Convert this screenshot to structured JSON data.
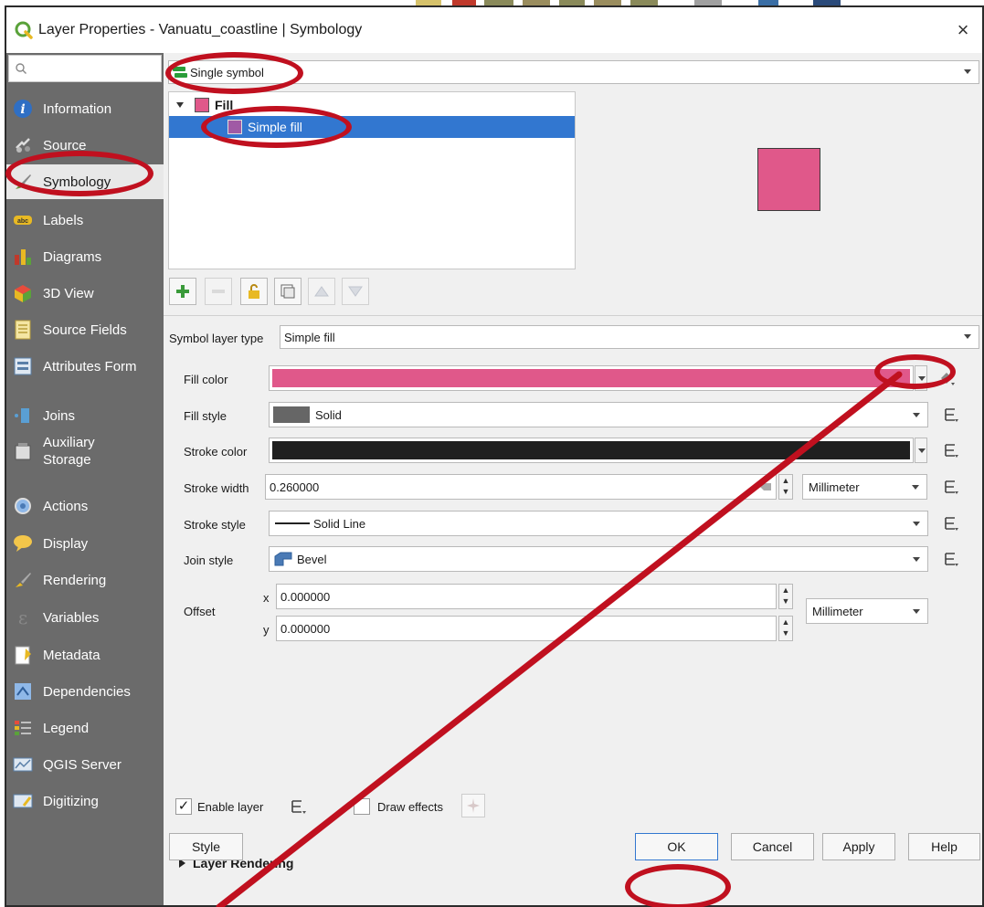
{
  "window": {
    "title": "Layer Properties - Vanuatu_coastline | Symbology",
    "close_glyph": "×"
  },
  "sidebar": {
    "items": [
      {
        "label": "Information",
        "icon": "info-icon"
      },
      {
        "label": "Source",
        "icon": "source-icon"
      },
      {
        "label": "Symbology",
        "icon": "symbology-brush-icon",
        "active": true
      },
      {
        "label": "Labels",
        "icon": "labels-abc-icon"
      },
      {
        "label": "Diagrams",
        "icon": "diagrams-icon"
      },
      {
        "label": "3D View",
        "icon": "3d-view-icon"
      },
      {
        "label": "Source Fields",
        "icon": "source-fields-icon"
      },
      {
        "label": "Attributes Form",
        "icon": "attributes-form-icon"
      },
      {
        "label": "Joins",
        "icon": "joins-icon"
      },
      {
        "label": "Auxiliary Storage",
        "icon": "auxiliary-storage-icon"
      },
      {
        "label": "Actions",
        "icon": "actions-gear-icon"
      },
      {
        "label": "Display",
        "icon": "display-speech-icon"
      },
      {
        "label": "Rendering",
        "icon": "rendering-brush-icon"
      },
      {
        "label": "Variables",
        "icon": "variables-epsilon-icon"
      },
      {
        "label": "Metadata",
        "icon": "metadata-icon"
      },
      {
        "label": "Dependencies",
        "icon": "dependencies-icon"
      },
      {
        "label": "Legend",
        "icon": "legend-icon"
      },
      {
        "label": "QGIS Server",
        "icon": "qgis-server-icon"
      },
      {
        "label": "Digitizing",
        "icon": "digitizing-icon"
      }
    ]
  },
  "renderer": {
    "selected": "Single symbol"
  },
  "symbol_tree": {
    "root_label": "Fill",
    "child_label": "Simple fill"
  },
  "symbol_layer": {
    "type_label": "Symbol layer type",
    "type_value": "Simple fill",
    "fill_color_label": "Fill color",
    "fill_color": "#e0588a",
    "fill_style_label": "Fill style",
    "fill_style_value": "Solid",
    "stroke_color_label": "Stroke color",
    "stroke_color": "#1f1f1f",
    "stroke_width_label": "Stroke width",
    "stroke_width_value": "0.260000",
    "stroke_width_unit": "Millimeter",
    "stroke_style_label": "Stroke style",
    "stroke_style_value": "Solid Line",
    "join_style_label": "Join style",
    "join_style_value": "Bevel",
    "offset_label": "Offset",
    "offset_x_label": "x",
    "offset_x_value": "0.000000",
    "offset_y_label": "y",
    "offset_y_value": "0.000000",
    "offset_unit": "Millimeter"
  },
  "footer_options": {
    "enable_layer_label": "Enable layer",
    "enable_layer_checked": true,
    "draw_effects_label": "Draw effects",
    "draw_effects_checked": false,
    "layer_rendering_label": "Layer Rendering"
  },
  "buttons": {
    "style": "Style",
    "ok": "OK",
    "cancel": "Cancel",
    "apply": "Apply",
    "help": "Help"
  },
  "annotation_color": "#c0101f"
}
